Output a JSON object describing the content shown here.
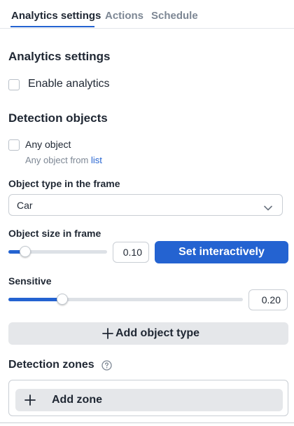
{
  "tabs": [
    {
      "label": "Analytics settings",
      "active": true
    },
    {
      "label": "Actions",
      "active": false
    },
    {
      "label": "Schedule",
      "active": false
    }
  ],
  "analytics": {
    "title": "Analytics settings",
    "enable_label": "Enable analytics",
    "enabled": false
  },
  "detection": {
    "title": "Detection objects",
    "any_object_label": "Any object",
    "any_object_checked": false,
    "any_object_hint_prefix": "Any object from",
    "any_object_hint_link": "list"
  },
  "object_type": {
    "label": "Object type in the frame",
    "value": "Car",
    "icon": "chevron-down-icon"
  },
  "object_size": {
    "label": "Object size in frame",
    "value_text": "0.10",
    "value": 0.1,
    "button_label": "Set interactively"
  },
  "sensitive": {
    "label": "Sensitive",
    "value_text": "0.20",
    "value": 0.2
  },
  "add_object_type": {
    "label": "Add object type",
    "icon": "plus-icon"
  },
  "zones": {
    "title": "Detection zones",
    "help_icon": "question-circle-icon",
    "add_zone_label": "Add zone",
    "add_icon": "plus-icon"
  },
  "colors": {
    "accent": "#2463d1",
    "text": "#1f2733",
    "muted": "#7d8794",
    "button_gray": "#e5e7ea"
  }
}
